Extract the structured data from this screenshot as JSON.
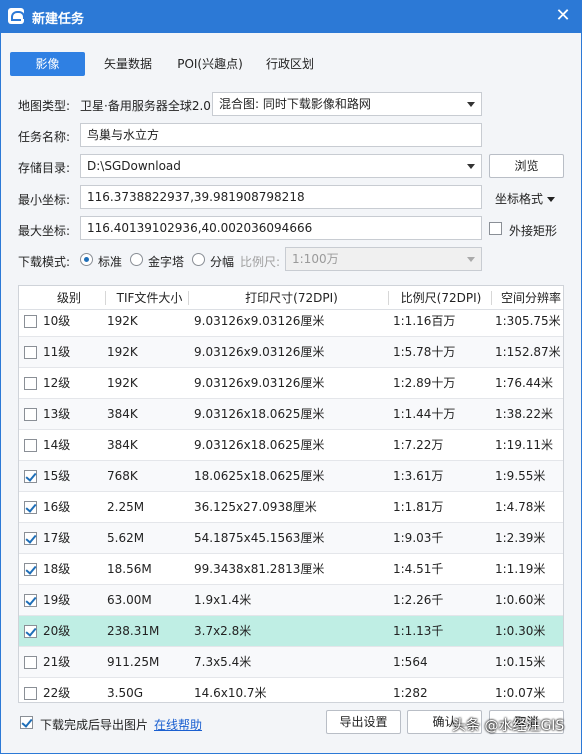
{
  "window": {
    "title": "新建任务",
    "close_glyph": "✕"
  },
  "tabs": [
    {
      "label": "影像",
      "active": true
    },
    {
      "label": "矢量数据",
      "active": false
    },
    {
      "label": "POI(兴趣点)",
      "active": false
    },
    {
      "label": "行政区划",
      "active": false
    }
  ],
  "form": {
    "map_type_label": "地图类型:",
    "map_type_value": "卫星·备用服务器全球2.0",
    "mix_value": "混合图: 同时下载影像和路网",
    "task_name_label": "任务名称:",
    "task_name_value": "鸟巢与水立方",
    "storage_label": "存储目录:",
    "storage_value": "D:\\SGDownload",
    "browse_label": "浏览",
    "min_coord_label": "最小坐标:",
    "min_coord_value": "116.3738822937,39.981908798218",
    "coord_format_label": "坐标格式",
    "max_coord_label": "最大坐标:",
    "max_coord_value": "116.40139102936,40.002036094666",
    "outer_rect_label": "外接矩形",
    "outer_rect_checked": false,
    "download_mode_label": "下载模式:",
    "modes": [
      {
        "label": "标准",
        "selected": true,
        "disabled": false
      },
      {
        "label": "金字塔",
        "selected": false,
        "disabled": false
      },
      {
        "label": "分幅",
        "selected": false,
        "disabled": false
      }
    ],
    "scale_label": "比例尺:",
    "scale_value": "1:100万"
  },
  "table": {
    "headers": [
      "级别",
      "TIF文件大小",
      "打印尺寸(72DPI)",
      "比例尺(72DPI)",
      "空间分辨率"
    ],
    "rows": [
      {
        "level": "10级",
        "size": "192K",
        "print": "9.03126x9.03126厘米",
        "scale": "1:1.16百万",
        "res": "1:305.75米",
        "checked": false
      },
      {
        "level": "11级",
        "size": "192K",
        "print": "9.03126x9.03126厘米",
        "scale": "1:5.78十万",
        "res": "1:152.87米",
        "checked": false
      },
      {
        "level": "12级",
        "size": "192K",
        "print": "9.03126x9.03126厘米",
        "scale": "1:2.89十万",
        "res": "1:76.44米",
        "checked": false
      },
      {
        "level": "13级",
        "size": "384K",
        "print": "9.03126x18.0625厘米",
        "scale": "1:1.44十万",
        "res": "1:38.22米",
        "checked": false
      },
      {
        "level": "14级",
        "size": "384K",
        "print": "9.03126x18.0625厘米",
        "scale": "1:7.22万",
        "res": "1:19.11米",
        "checked": false
      },
      {
        "level": "15级",
        "size": "768K",
        "print": "18.0625x18.0625厘米",
        "scale": "1:3.61万",
        "res": "1:9.55米",
        "checked": true
      },
      {
        "level": "16级",
        "size": "2.25M",
        "print": "36.125x27.0938厘米",
        "scale": "1:1.81万",
        "res": "1:4.78米",
        "checked": true
      },
      {
        "level": "17级",
        "size": "5.62M",
        "print": "54.1875x45.1563厘米",
        "scale": "1:9.03千",
        "res": "1:2.39米",
        "checked": true
      },
      {
        "level": "18级",
        "size": "18.56M",
        "print": "99.3438x81.2813厘米",
        "scale": "1:4.51千",
        "res": "1:1.19米",
        "checked": true
      },
      {
        "level": "19级",
        "size": "63.00M",
        "print": "1.9x1.4米",
        "scale": "1:2.26千",
        "res": "1:0.60米",
        "checked": true
      },
      {
        "level": "20级",
        "size": "238.31M",
        "print": "3.7x2.8米",
        "scale": "1:1.13千",
        "res": "1:0.30米",
        "checked": true,
        "selected": true
      },
      {
        "level": "21级",
        "size": "911.25M",
        "print": "7.3x5.4米",
        "scale": "1:564",
        "res": "1:0.15米",
        "checked": false
      },
      {
        "level": "22级",
        "size": "3.50G",
        "print": "14.6x10.7米",
        "scale": "1:282",
        "res": "1:0.07米",
        "checked": false
      }
    ]
  },
  "footer": {
    "export_after_label": "下载完成后导出图片",
    "export_after_checked": true,
    "help_link": "在线帮助",
    "export_settings_label": "导出设置",
    "ok_label": "确认",
    "cancel_label": "取消"
  },
  "watermark": "头条 @水经注GIS",
  "colors": {
    "titlebar": "#2c79d6",
    "active_tab": "#2f80e3",
    "selected_row": "#bfeee4",
    "link": "#1a5fd0"
  }
}
